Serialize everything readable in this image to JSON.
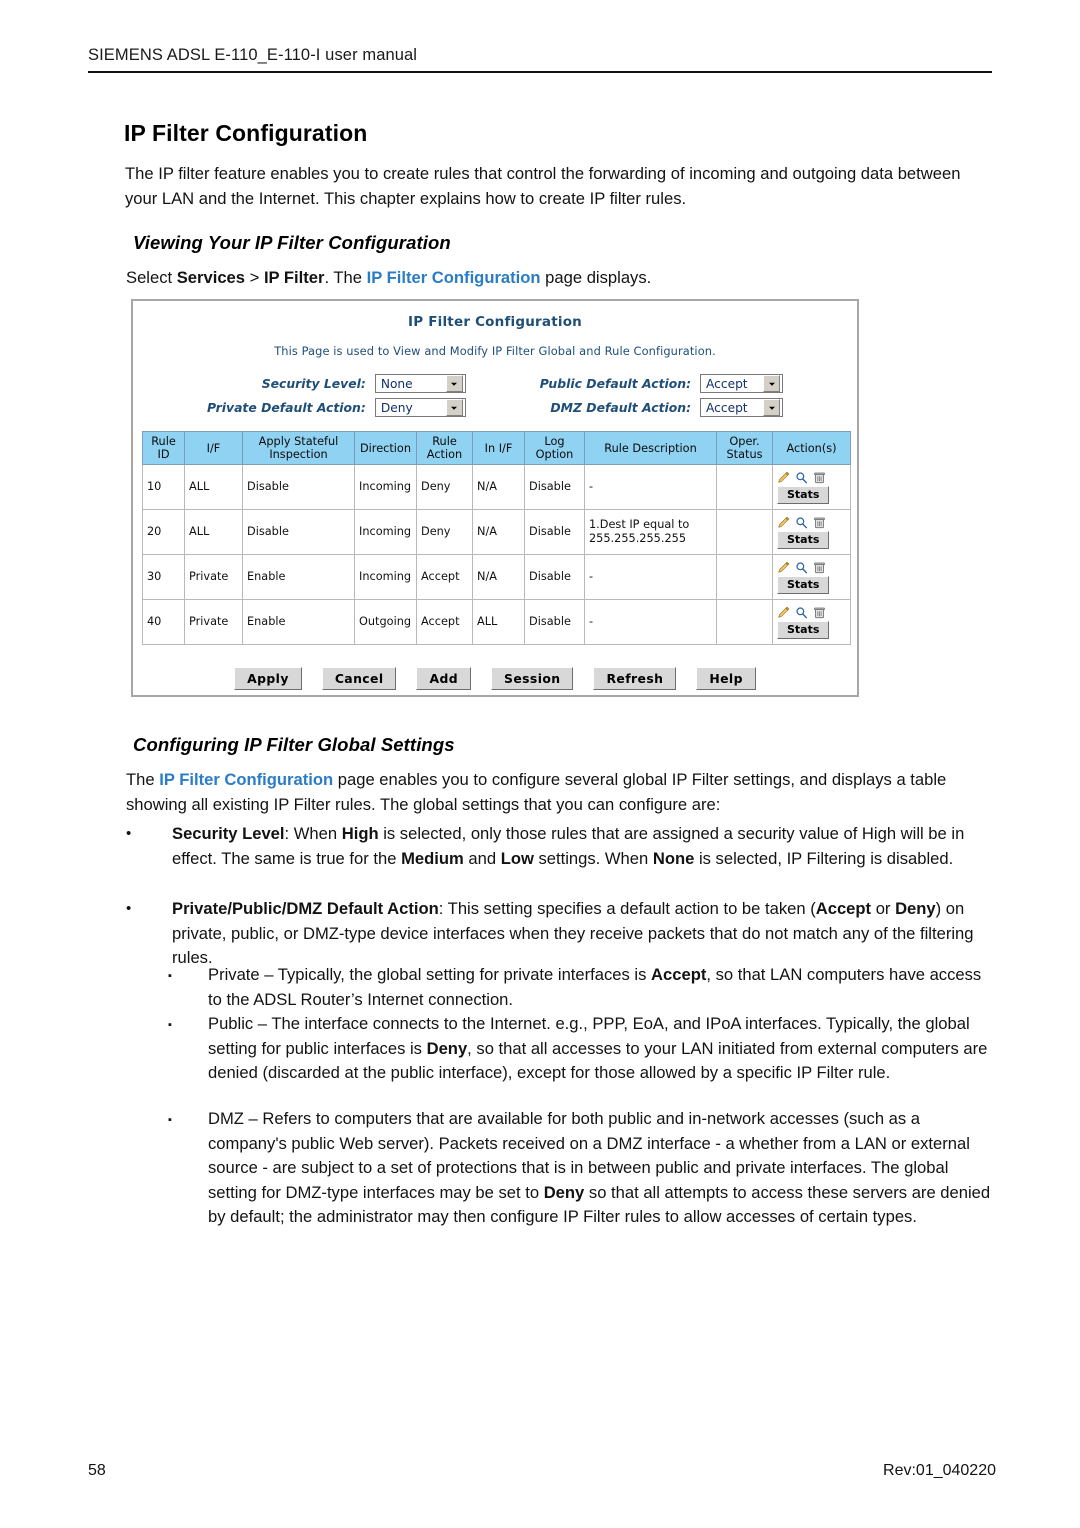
{
  "doc": {
    "running_header": "SIEMENS ADSL E-110_E-110-I user manual",
    "title": "IP Filter Configuration",
    "intro": "The IP filter feature enables you to create rules that control the forwarding of incoming and outgoing data between your LAN and the Internet. This chapter explains how to create IP filter rules.",
    "footer_page": "58",
    "footer_rev": "Rev:01_040220"
  },
  "section_viewing": {
    "heading": "Viewing Your IP Filter Configuration",
    "select_line": {
      "prefix": "Select ",
      "menu1": "Services",
      "sep": " > ",
      "menu2": "IP Filter",
      "middle": ". The ",
      "accent": "IP Filter Configuration",
      "suffix": " page displays."
    }
  },
  "section_configuring": {
    "heading": "Configuring IP Filter Global Settings",
    "intro": {
      "prefix": "The ",
      "accent": "IP Filter Configuration",
      "suffix": " page enables you to configure several global IP Filter settings, and displays a table showing all existing IP Filter rules. The global settings that you can configure are:"
    },
    "bullets": [
      {
        "marker": "•",
        "term": "Security Level",
        "text_1": ": When ",
        "b1": "High",
        "text_2": " is selected, only those rules that are assigned a security value of High will be in effect. The same is true for the ",
        "b2": "Medium",
        "text_3": " and ",
        "b3": "Low",
        "text_4": " settings. When ",
        "b4": "None",
        "text_5": " is selected, IP Filtering is disabled."
      },
      {
        "marker": "•",
        "term": "Private/Public/DMZ Default Action",
        "text_1": ": This setting specifies a default action to be taken (",
        "b1": "Accept",
        "text_2": " or ",
        "b2": "Deny",
        "text_3": ") on private, public, or DMZ-type device interfaces when they receive packets that do not match any of the filtering rules."
      }
    ],
    "sub_bullets": [
      {
        "marker": "▪",
        "text_1": "Private – Typically, the global setting for private interfaces is ",
        "b1": "Accept",
        "text_2": ", so that LAN computers have access to the ADSL Router’s Internet connection."
      },
      {
        "marker": "▪",
        "text_1": "Public – The interface connects to the Internet. e.g., PPP, EoA, and IPoA interfaces. Typically, the global setting for public interfaces is ",
        "b1": "Deny",
        "text_2": ", so that all accesses to your LAN initiated from external computers are denied (discarded at the public interface), except for those allowed by a specific IP Filter rule."
      },
      {
        "marker": "▪",
        "text_1": "DMZ – Refers to computers that are available for both public and in-network accesses (such as a company's public Web server). Packets received on a DMZ interface - a whether from a LAN or external source - are subject to a set of protections that is in between public and private interfaces. The global setting for DMZ-type interfaces may be set to ",
        "b1": "Deny",
        "text_2": " so that all attempts to access these servers are denied by default; the administrator may then configure IP Filter rules to allow accesses of certain types."
      }
    ]
  },
  "screenshot": {
    "title": "IP Filter Configuration",
    "subtitle": "This Page is used to View and Modify IP Filter Global and Rule Configuration.",
    "globals": [
      {
        "label": "Security Level:",
        "value": "None"
      },
      {
        "label": "Public Default Action:",
        "value": "Accept"
      },
      {
        "label": "Private Default Action:",
        "value": "Deny"
      },
      {
        "label": "DMZ Default Action:",
        "value": "Accept"
      }
    ],
    "table": {
      "headers": [
        "Rule\nID",
        "I/F",
        "Apply Stateful\nInspection",
        "Direction",
        "Rule\nAction",
        "In I/F",
        "Log\nOption",
        "Rule Description",
        "Oper.\nStatus",
        "Action(s)"
      ],
      "headers_flat": [
        "Rule ID",
        "I/F",
        "Apply Stateful Inspection",
        "Direction",
        "Rule Action",
        "In I/F",
        "Log Option",
        "Rule Description",
        "Oper. Status",
        "Action(s)"
      ],
      "rows": [
        {
          "rule_id": "10",
          "if": "ALL",
          "stateful": "Disable",
          "direction": "Incoming",
          "rule_action": "Deny",
          "in_if": "N/A",
          "log_option": "Disable",
          "description": "-",
          "status": "red",
          "stats_label": "Stats"
        },
        {
          "rule_id": "20",
          "if": "ALL",
          "stateful": "Disable",
          "direction": "Incoming",
          "rule_action": "Deny",
          "in_if": "N/A",
          "log_option": "Disable",
          "description": "1.Dest IP equal to 255.255.255.255",
          "status": "red",
          "stats_label": "Stats"
        },
        {
          "rule_id": "30",
          "if": "Private",
          "stateful": "Enable",
          "direction": "Incoming",
          "rule_action": "Accept",
          "in_if": "N/A",
          "log_option": "Disable",
          "description": "-",
          "status": "red",
          "stats_label": "Stats"
        },
        {
          "rule_id": "40",
          "if": "Private",
          "stateful": "Enable",
          "direction": "Outgoing",
          "rule_action": "Accept",
          "in_if": "ALL",
          "log_option": "Disable",
          "description": "-",
          "status": "red",
          "stats_label": "Stats"
        }
      ],
      "row_icons": [
        "edit-pencil-icon",
        "view-magnifier-icon",
        "delete-trash-icon"
      ]
    },
    "buttons": [
      "Apply",
      "Cancel",
      "Add",
      "Session",
      "Refresh",
      "Help"
    ],
    "colors": {
      "title_blue": "#1f4e79",
      "header_cyan": "#8fd2f2",
      "status_red": "#ef2a1c"
    }
  },
  "theme": {
    "accent_blue": "#2a7cc7"
  }
}
